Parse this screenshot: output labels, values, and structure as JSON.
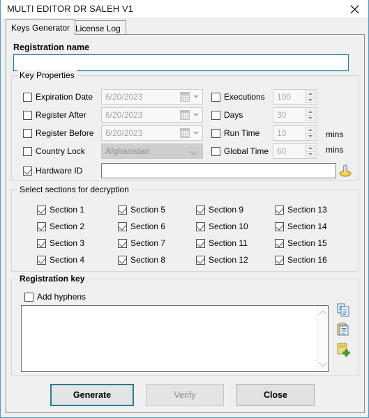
{
  "window": {
    "title": "MULTI EDITOR DR SALEH V1",
    "close_icon": "close-icon"
  },
  "tabs": [
    {
      "label": "Keys Generator",
      "active": true
    },
    {
      "label": "License Log",
      "active": false
    }
  ],
  "registration_name": {
    "label": "Registration name",
    "value": "",
    "placeholder": ""
  },
  "key_properties": {
    "title": "Key Properties",
    "left_rows": [
      {
        "name": "expiration-date",
        "label": "Expiration Date",
        "checked": false,
        "control": "datepicker",
        "value": "6/20/2023"
      },
      {
        "name": "register-after",
        "label": "Register After",
        "checked": false,
        "control": "datepicker",
        "value": "6/20/2023"
      },
      {
        "name": "register-before",
        "label": "Register Before",
        "checked": false,
        "control": "datepicker",
        "value": "6/20/2023"
      },
      {
        "name": "country-lock",
        "label": "Country Lock",
        "checked": false,
        "control": "combobox",
        "value": "Afghanistan"
      },
      {
        "name": "hardware-id",
        "label": "Hardware ID",
        "checked": true,
        "control": "textbox",
        "value": ""
      }
    ],
    "right_rows": [
      {
        "name": "executions",
        "label": "Executions",
        "checked": false,
        "value": "100",
        "suffix": ""
      },
      {
        "name": "days",
        "label": "Days",
        "checked": false,
        "value": "30",
        "suffix": ""
      },
      {
        "name": "run-time",
        "label": "Run Time",
        "checked": false,
        "value": "10",
        "suffix": "mins"
      },
      {
        "name": "global-time",
        "label": "Global Time",
        "checked": false,
        "value": "60",
        "suffix": "mins"
      }
    ],
    "hwid_icon": "key-icon"
  },
  "sections": {
    "title": "Select sections for decryption",
    "items": [
      {
        "label": "Section 1",
        "checked": true
      },
      {
        "label": "Section 5",
        "checked": true
      },
      {
        "label": "Section 9",
        "checked": true
      },
      {
        "label": "Section 13",
        "checked": true
      },
      {
        "label": "Section 2",
        "checked": true
      },
      {
        "label": "Section 6",
        "checked": true
      },
      {
        "label": "Section 10",
        "checked": true
      },
      {
        "label": "Section 14",
        "checked": true
      },
      {
        "label": "Section 3",
        "checked": true
      },
      {
        "label": "Section 7",
        "checked": true
      },
      {
        "label": "Section 11",
        "checked": true
      },
      {
        "label": "Section 15",
        "checked": true
      },
      {
        "label": "Section 4",
        "checked": true
      },
      {
        "label": "Section 8",
        "checked": true
      },
      {
        "label": "Section 12",
        "checked": true
      },
      {
        "label": "Section 16",
        "checked": true
      }
    ]
  },
  "registration_key": {
    "title": "Registration key",
    "add_hyphens": {
      "label": "Add hyphens",
      "checked": false
    },
    "value": "",
    "side_icons": [
      {
        "name": "copy-icon"
      },
      {
        "name": "paste-icon"
      },
      {
        "name": "save-add-icon"
      }
    ]
  },
  "buttons": [
    {
      "name": "generate-button",
      "label": "Generate",
      "state": "default"
    },
    {
      "name": "verify-button",
      "label": "Verify",
      "state": "disabled"
    },
    {
      "name": "close-button",
      "label": "Close",
      "state": "normal"
    }
  ],
  "colors": {
    "accent": "#2c7a94",
    "window_bg": "#f0f0f0",
    "field_bg": "#ffffff",
    "disabled_text": "#a3a3a3"
  }
}
